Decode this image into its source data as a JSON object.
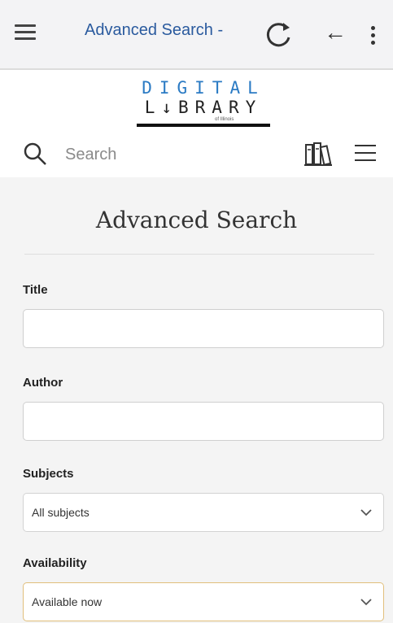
{
  "appbar": {
    "title": "Advanced Search -",
    "menu_icon": "hamburger-icon",
    "reload_icon": "reload-icon",
    "back_icon": "arrow-left-icon",
    "back_glyph": "←",
    "more_icon": "more-vert-icon"
  },
  "logo": {
    "line1": "DIGITAL",
    "line2": "L↓BRARY",
    "subtitle": "of Illinois",
    "accent_color": "#2b7bc4"
  },
  "search": {
    "placeholder": "Search",
    "value": ""
  },
  "page": {
    "heading": "Advanced Search"
  },
  "form": {
    "title_label": "Title",
    "title_value": "",
    "author_label": "Author",
    "author_value": "",
    "subjects_label": "Subjects",
    "subjects_selected": "All subjects",
    "availability_label": "Availability",
    "availability_selected": "Available now"
  }
}
